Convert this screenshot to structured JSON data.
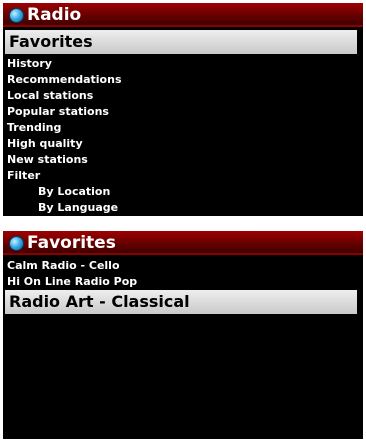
{
  "screen1": {
    "title": "Radio",
    "items": [
      {
        "label": "Favorites",
        "selected": true
      },
      {
        "label": "History"
      },
      {
        "label": "Recommendations"
      },
      {
        "label": "Local stations"
      },
      {
        "label": "Popular stations"
      },
      {
        "label": "Trending"
      },
      {
        "label": "High quality"
      },
      {
        "label": "New stations"
      },
      {
        "label": "Filter"
      },
      {
        "label": "By Location",
        "indent": true
      },
      {
        "label": "By Language",
        "indent": true
      }
    ]
  },
  "screen2": {
    "title": "Favorites",
    "items": [
      {
        "label": "Calm Radio - Cello"
      },
      {
        "label": "Hi On Line Radio Pop"
      },
      {
        "label": "Radio Art - Classical",
        "selected": true
      }
    ]
  },
  "colors": {
    "titlebar": "#8a0000",
    "background": "#000000",
    "highlight": "#e0e0e0"
  }
}
